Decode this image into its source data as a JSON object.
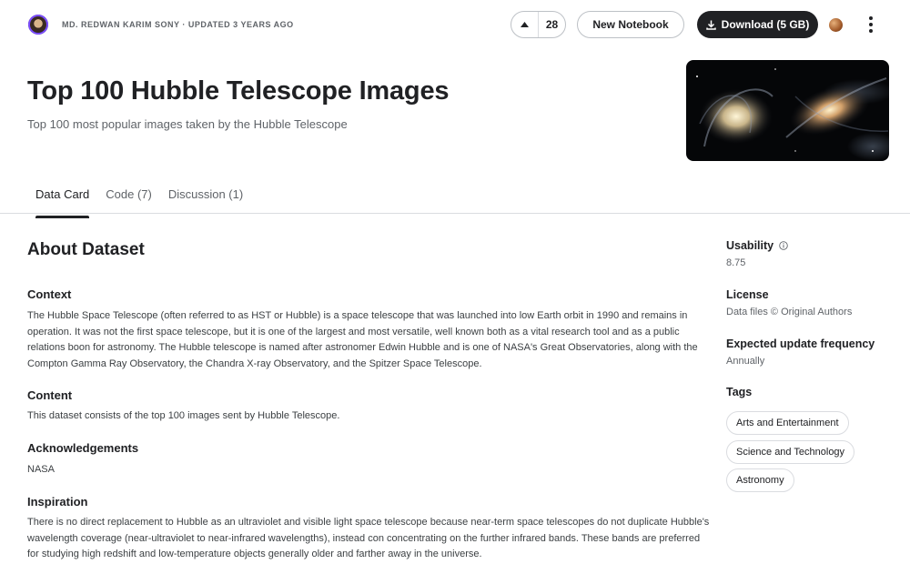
{
  "header": {
    "byline": "MD. REDWAN KARIM SONY · UPDATED 3 YEARS AGO",
    "upvote_count": "28",
    "new_notebook_label": "New Notebook",
    "download_label": "Download (5 GB)"
  },
  "dataset": {
    "title": "Top 100 Hubble Telescope Images",
    "subtitle": "Top 100 most popular images taken by the Hubble Telescope"
  },
  "tabs": [
    {
      "label": "Data Card",
      "active": true
    },
    {
      "label": "Code (7)",
      "active": false
    },
    {
      "label": "Discussion (1)",
      "active": false
    }
  ],
  "about": {
    "heading": "About Dataset",
    "sections": [
      {
        "title": "Context",
        "text": "The Hubble Space Telescope (often referred to as HST or Hubble) is a space telescope that was launched into low Earth orbit in 1990 and remains in operation. It was not the first space telescope, but it is one of the largest and most versatile, well known both as a vital research tool and as a public relations boon for astronomy. The Hubble telescope is named after astronomer Edwin Hubble and is one of NASA's Great Observatories, along with the Compton Gamma Ray Observatory, the Chandra X-ray Observatory, and the Spitzer Space Telescope."
      },
      {
        "title": "Content",
        "text": "This dataset consists of the top 100 images sent by Hubble Telescope."
      },
      {
        "title": "Acknowledgements",
        "text": "NASA"
      },
      {
        "title": "Inspiration",
        "text": "There is no direct replacement to Hubble as an ultraviolet and visible light space telescope because near-term space telescopes do not duplicate Hubble's wavelength coverage (near-ultraviolet to near-infrared wavelengths), instead con concentrating on the further infrared bands. These bands are preferred for studying high redshift and low-temperature objects generally older and farther away in the universe."
      }
    ]
  },
  "sidebar": {
    "usability_label": "Usability",
    "usability_value": "8.75",
    "license_label": "License",
    "license_value": "Data files © Original Authors",
    "frequency_label": "Expected update frequency",
    "frequency_value": "Annually",
    "tags_label": "Tags",
    "tags": [
      "Arts and Entertainment",
      "Science and Technology",
      "Astronomy"
    ]
  },
  "icons": {
    "upvote": "upvote-arrow-icon",
    "download": "download-icon",
    "info": "info-icon",
    "more": "more-vertical-icon"
  },
  "colors": {
    "primary_button_bg": "#202124",
    "text_primary": "#202124",
    "text_secondary": "#5f6368",
    "border": "#dadce0"
  }
}
